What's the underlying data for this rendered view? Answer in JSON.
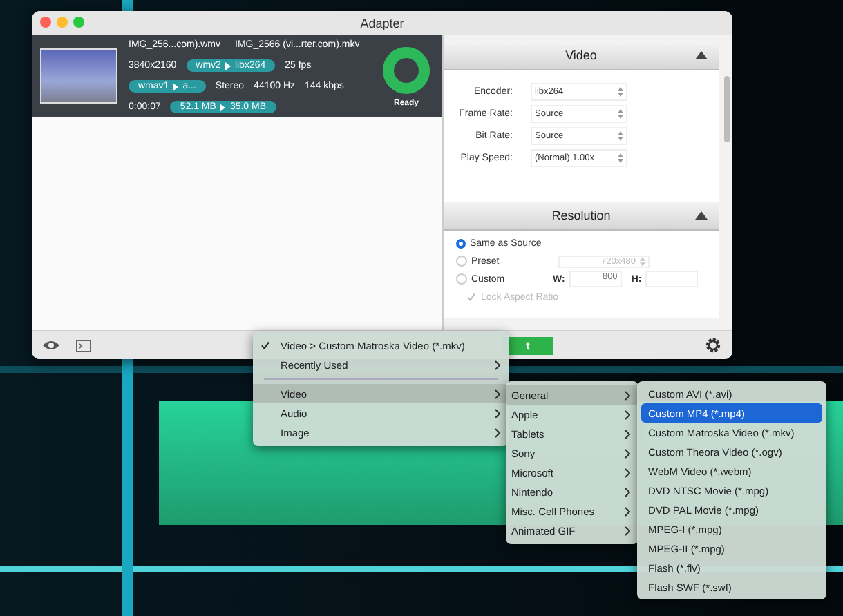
{
  "window": {
    "title": "Adapter"
  },
  "file": {
    "source_name": "IMG_256...com).wmv",
    "output_name": "IMG_2566 (vi...rter.com).mkv",
    "resolution": "3840x2160",
    "video_codec": {
      "from": "wmv2",
      "to": "libx264"
    },
    "frame_rate": "25 fps",
    "audio_codec": {
      "from": "wmav1",
      "to": "a..."
    },
    "channels": "Stereo",
    "sample_rate": "44100 Hz",
    "audio_bitrate": "144 kbps",
    "duration": "0:00:07",
    "size": {
      "from": "52.1 MB",
      "to": "35.0 MB"
    },
    "status": "Ready",
    "level": 1
  },
  "video_section": {
    "title": "Video",
    "expanded": true,
    "fields": [
      {
        "label": "Encoder:",
        "value": "libx264"
      },
      {
        "label": "Frame Rate:",
        "value": "Source"
      },
      {
        "label": "Bit Rate:",
        "value": "Source"
      },
      {
        "label": "Play Speed:",
        "value": "(Normal) 1.00x"
      }
    ]
  },
  "resolution_section": {
    "title": "Resolution",
    "expanded": true,
    "options": [
      {
        "label": "Same as Source",
        "selected": true
      },
      {
        "label": "Preset",
        "selected": false
      },
      {
        "label": "Custom",
        "selected": false
      }
    ],
    "preset_value": "720x480",
    "width_label": "W:",
    "width_value": "800",
    "height_label": "H:",
    "lock_aspect": {
      "label": "Lock Aspect Ratio",
      "checked": true,
      "disabled": true
    }
  },
  "toolbar": {
    "convert_button": "t"
  },
  "menu": [
    {
      "kind": "item",
      "label": "Video > Custom Matroska Video (*.mkv)",
      "checked": true,
      "submenu": false,
      "selected": false
    },
    {
      "kind": "item",
      "label": "Recently Used",
      "checked": false,
      "submenu": true,
      "selected": false
    },
    {
      "kind": "separator"
    },
    {
      "kind": "item",
      "label": "Video",
      "checked": false,
      "submenu": true,
      "selected": true
    },
    {
      "kind": "item",
      "label": "Audio",
      "checked": false,
      "submenu": true,
      "selected": false
    },
    {
      "kind": "item",
      "label": "Image",
      "checked": false,
      "submenu": true,
      "selected": false
    }
  ],
  "submenu": [
    {
      "label": "General",
      "selected": true
    },
    {
      "label": "Apple",
      "selected": false
    },
    {
      "label": "Tablets",
      "selected": false
    },
    {
      "label": "Sony",
      "selected": false
    },
    {
      "label": "Microsoft",
      "selected": false
    },
    {
      "label": "Nintendo",
      "selected": false
    },
    {
      "label": "Misc. Cell Phones",
      "selected": false
    },
    {
      "label": "Animated GIF",
      "selected": false
    }
  ],
  "formats": [
    {
      "label": "Custom AVI (*.avi)",
      "selected": false
    },
    {
      "label": "Custom MP4 (*.mp4)",
      "selected": true
    },
    {
      "label": "Custom Matroska Video (*.mkv)",
      "selected": false
    },
    {
      "label": "Custom Theora Video (*.ogv)",
      "selected": false
    },
    {
      "label": "WebM Video (*.webm)",
      "selected": false
    },
    {
      "label": "DVD NTSC Movie (*.mpg)",
      "selected": false
    },
    {
      "label": "DVD PAL Movie (*.mpg)",
      "selected": false
    },
    {
      "label": "MPEG-I (*.mpg)",
      "selected": false
    },
    {
      "label": "MPEG-II (*.mpg)",
      "selected": false
    },
    {
      "label": "Flash (*.flv)",
      "selected": false
    },
    {
      "label": "Flash SWF (*.swf)",
      "selected": false
    }
  ]
}
